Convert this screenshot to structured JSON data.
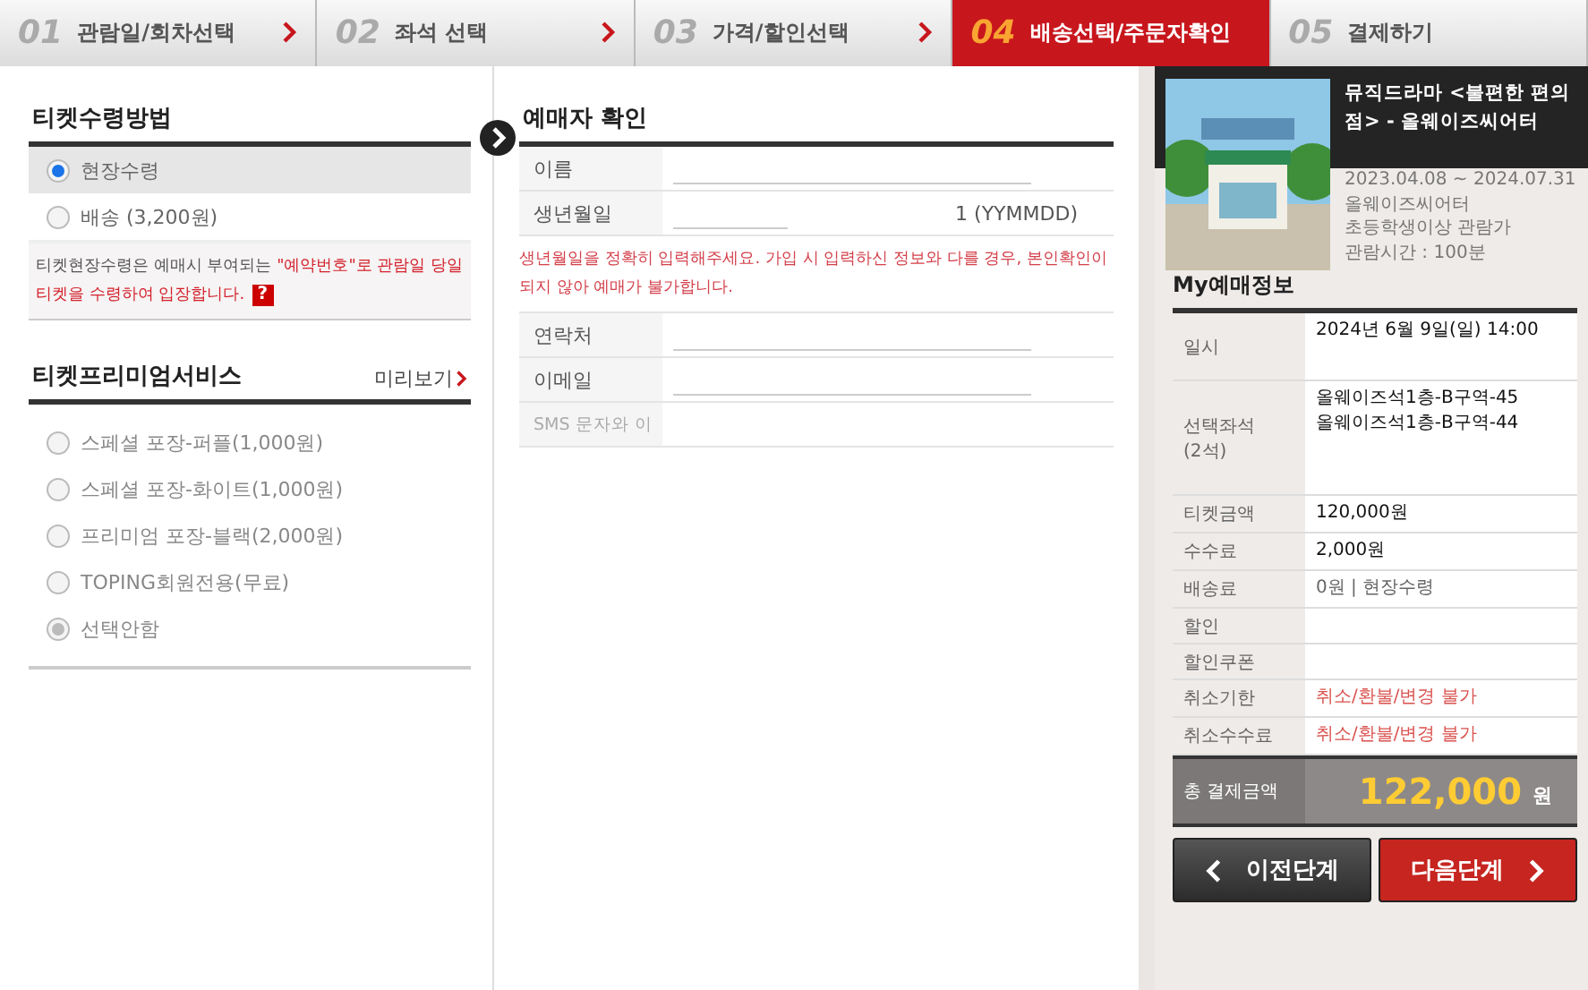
{
  "steps": [
    {
      "num": "01",
      "label": "관람일/회차선택",
      "selected": false
    },
    {
      "num": "02",
      "label": "좌석 선택",
      "selected": false
    },
    {
      "num": "03",
      "label": "가격/할인선택",
      "selected": false
    },
    {
      "num": "04",
      "label": "배송선택/주문자확인",
      "selected": true
    },
    {
      "num": "05",
      "label": "결제하기",
      "selected": false
    }
  ],
  "receipt": {
    "title": "티켓수령방법",
    "options": [
      {
        "label": "현장수령",
        "selected": true
      },
      {
        "label": "배송 (3,200원)",
        "selected": false
      }
    ],
    "notice": {
      "text": "티켓현장수령은 예매시 부여되는 ",
      "highlight": "\"예약번호\"로 관람일 당일 티켓을 수령하여 입장합니다.",
      "help": "?"
    }
  },
  "premium": {
    "title": "티켓프리미엄서비스",
    "preview": "미리보기",
    "options": [
      {
        "label": "스페셜 포장-퍼플(1,000원)",
        "selected": false
      },
      {
        "label": "스페셜 포장-화이트(1,000원)",
        "selected": false
      },
      {
        "label": "프리미엄 포장-블랙(2,000원)",
        "selected": false
      },
      {
        "label": "TOPING회원전용(무료)",
        "selected": false
      },
      {
        "label": "선택안함",
        "selected": true
      }
    ]
  },
  "buyer": {
    "title": "예매자 확인",
    "rows": [
      {
        "kind": "field",
        "label": "이름"
      },
      {
        "kind": "birth",
        "label": "생년월일",
        "suffix": "1 (YYMMDD)"
      },
      {
        "kind": "note",
        "text": "생년월일을 정확히 입력해주세요. 가입 시 입력하신 정보와 다를 경우, 본인확인이 되지 않아 예매가 불가합니다."
      },
      {
        "kind": "field",
        "label": "연락처"
      },
      {
        "kind": "field",
        "label": "이메일"
      },
      {
        "kind": "hint",
        "label": "SMS 문자와 이"
      }
    ]
  },
  "show": {
    "title": "뮤직드라마 <불편한 편의점> - 올웨이즈씨어터",
    "info": [
      "2023.04.08 ~ 2024.07.31",
      "올웨이즈씨어터",
      "초등학생이상 관람가",
      "관람시간 : 100분"
    ]
  },
  "my_booking": {
    "title": "My예매정보",
    "rows": [
      {
        "label": "일시",
        "value": "2024년 6월 9일(일) 14:00",
        "kind": "plain"
      },
      {
        "label": "선택좌석\n(2석)",
        "value": "올웨이즈석1층-B구역-45\n올웨이즈석1층-B구역-44",
        "kind": "tall"
      },
      {
        "label": "티켓금액",
        "value": "120,000원",
        "kind": "plain"
      },
      {
        "label": "수수료",
        "value": "2,000원",
        "kind": "plain"
      },
      {
        "label": "배송료",
        "value": "0원 | 현장수령",
        "kind": "muted"
      },
      {
        "label": "할인",
        "value": null,
        "kind": "plain"
      },
      {
        "label": "할인쿠폰",
        "value": null,
        "kind": "plain"
      },
      {
        "label": "취소기한",
        "value": "취소/환불/변경 불가",
        "kind": "warn"
      },
      {
        "label": "취소수수료",
        "value": "취소/환불/변경 불가",
        "kind": "warn"
      }
    ],
    "total_label": "총 결제금액",
    "total": "122,000",
    "unit": "원"
  },
  "buttons": {
    "prev": "이전단계",
    "next": "다음단계"
  }
}
